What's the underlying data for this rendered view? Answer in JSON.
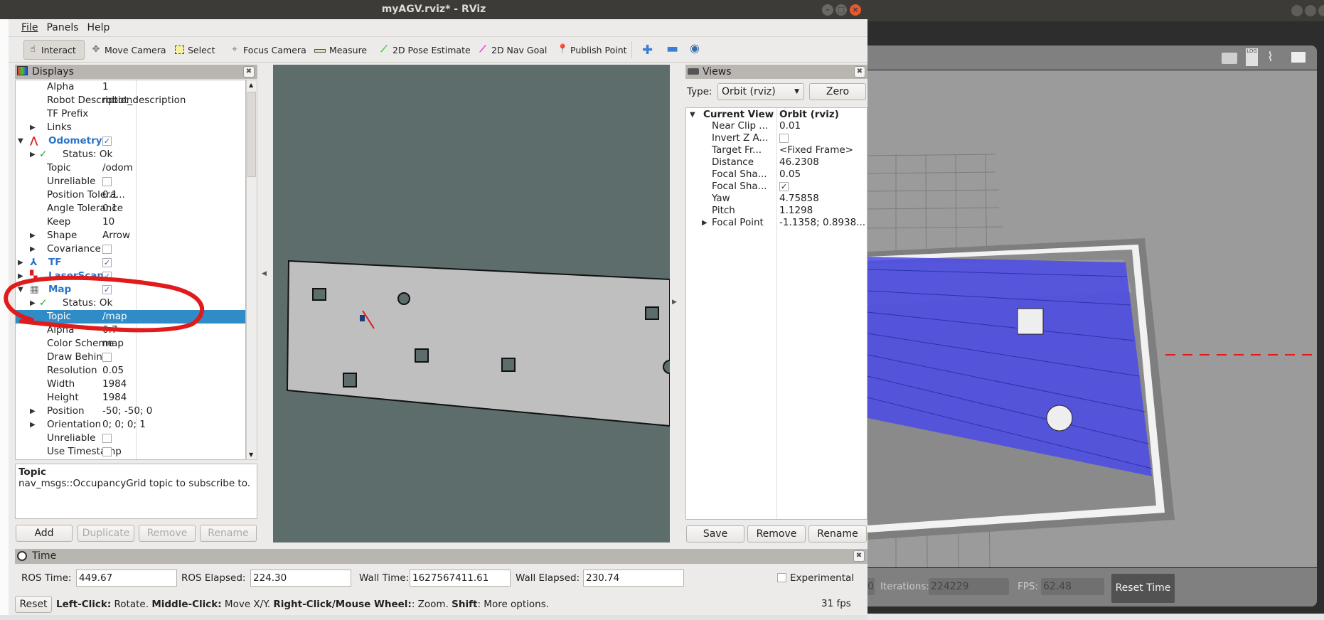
{
  "window": {
    "title": "myAGV.rviz* - RViz",
    "min": "–",
    "max": "□",
    "close": "×"
  },
  "menu": [
    "File",
    "Panels",
    "Help"
  ],
  "toolbar": [
    {
      "label": "Interact",
      "icon": "hand-icon",
      "active": true
    },
    {
      "label": "Move Camera",
      "icon": "move-camera-icon"
    },
    {
      "label": "Select",
      "icon": "select-icon"
    },
    {
      "label": "Focus Camera",
      "icon": "focus-camera-icon"
    },
    {
      "label": "Measure",
      "icon": "ruler-icon"
    },
    {
      "label": "2D Pose Estimate",
      "icon": "pose-arrow-icon",
      "color": "#1fc41f"
    },
    {
      "label": "2D Nav Goal",
      "icon": "goal-arrow-icon",
      "color": "#e01fd4"
    },
    {
      "label": "Publish Point",
      "icon": "map-pin-icon",
      "color": "#c0392b"
    }
  ],
  "displays": {
    "title": "Displays",
    "rows": [
      {
        "name": "Alpha",
        "value": "1",
        "lvl": 2
      },
      {
        "name": "Robot Description",
        "value": "robot_description",
        "lvl": 2
      },
      {
        "name": "TF Prefix",
        "value": "",
        "lvl": 2
      },
      {
        "name": "Links",
        "value": "",
        "lvl": 2,
        "exp": "closed"
      },
      {
        "name": "Odometry",
        "lvl": 0,
        "exp": "open",
        "group": true,
        "check": true,
        "icon": "odometry-icon"
      },
      {
        "name": "Status: Ok",
        "lvl": 1,
        "exp": "closed",
        "status": true
      },
      {
        "name": "Topic",
        "value": "/odom",
        "lvl": 2
      },
      {
        "name": "Unreliable",
        "lvl": 2,
        "check": false
      },
      {
        "name": "Position Tolera...",
        "value": "0.1",
        "lvl": 2
      },
      {
        "name": "Angle Tolerance",
        "value": "0.1",
        "lvl": 2
      },
      {
        "name": "Keep",
        "value": "10",
        "lvl": 2
      },
      {
        "name": "Shape",
        "value": "Arrow",
        "lvl": 2,
        "exp": "closed"
      },
      {
        "name": "Covariance",
        "lvl": 2,
        "exp": "closed",
        "check": false
      },
      {
        "name": "TF",
        "lvl": 0,
        "exp": "closed",
        "group": true,
        "check": true,
        "icon": "tf-icon"
      },
      {
        "name": "LaserScan",
        "lvl": 0,
        "exp": "closed",
        "group": true,
        "check": true,
        "icon": "laserscan-icon"
      },
      {
        "name": "Map",
        "lvl": 0,
        "exp": "open",
        "group": true,
        "check": true,
        "icon": "map-icon"
      },
      {
        "name": "Status: Ok",
        "lvl": 1,
        "exp": "closed",
        "status": true
      },
      {
        "name": "Topic",
        "value": "/map",
        "lvl": 2,
        "selected": true
      },
      {
        "name": "Alpha",
        "value": "0.7",
        "lvl": 2
      },
      {
        "name": "Color Scheme",
        "value": "map",
        "lvl": 2
      },
      {
        "name": "Draw Behind",
        "lvl": 2,
        "check": false
      },
      {
        "name": "Resolution",
        "value": "0.05",
        "lvl": 2
      },
      {
        "name": "Width",
        "value": "1984",
        "lvl": 2
      },
      {
        "name": "Height",
        "value": "1984",
        "lvl": 2
      },
      {
        "name": "Position",
        "value": "-50; -50; 0",
        "lvl": 2,
        "exp": "closed"
      },
      {
        "name": "Orientation",
        "value": "0; 0; 0; 1",
        "lvl": 2,
        "exp": "closed"
      },
      {
        "name": "Unreliable",
        "lvl": 2,
        "check": false
      },
      {
        "name": "Use Timestamp",
        "lvl": 2,
        "check": false
      }
    ],
    "desc_title": "Topic",
    "desc_text": "nav_msgs::OccupancyGrid topic to subscribe to.",
    "buttons": {
      "add": "Add",
      "duplicate": "Duplicate",
      "remove": "Remove",
      "rename": "Rename"
    }
  },
  "views": {
    "title": "Views",
    "type_label": "Type:",
    "type_value": "Orbit (rviz)",
    "zero": "Zero",
    "header": {
      "name": "Current View",
      "value": "Orbit (rviz)"
    },
    "rows": [
      {
        "name": "Near Clip ...",
        "value": "0.01"
      },
      {
        "name": "Invert Z A...",
        "check": false
      },
      {
        "name": "Target Fr...",
        "value": "<Fixed Frame>"
      },
      {
        "name": "Distance",
        "value": "46.2308"
      },
      {
        "name": "Focal Sha...",
        "value": "0.05"
      },
      {
        "name": "Focal Sha...",
        "check": true
      },
      {
        "name": "Yaw",
        "value": "4.75858"
      },
      {
        "name": "Pitch",
        "value": "1.1298"
      },
      {
        "name": "Focal Point",
        "value": "-1.1358; 0.8938...",
        "exp": "closed"
      }
    ],
    "buttons": {
      "save": "Save",
      "remove": "Remove",
      "rename": "Rename"
    }
  },
  "time": {
    "title": "Time",
    "ros_time_label": "ROS Time:",
    "ros_time": "449.67",
    "ros_elapsed_label": "ROS Elapsed:",
    "ros_elapsed": "224.30",
    "wall_time_label": "Wall Time:",
    "wall_time": "1627567411.61",
    "wall_elapsed_label": "Wall Elapsed:",
    "wall_elapsed": "230.74",
    "experimental": "Experimental",
    "reset": "Reset",
    "hint": [
      {
        "b": "Left-Click:",
        "t": " Rotate. "
      },
      {
        "b": "Middle-Click:",
        "t": " Move X/Y. "
      },
      {
        "b": "Right-Click/Mouse Wheel:",
        "t": ": Zoom. "
      },
      {
        "b": "Shift",
        "t": ": More options."
      }
    ],
    "fps": "31 fps"
  },
  "gazebo": {
    "icons": [
      "camera-icon",
      "log-icon",
      "plot-icon",
      "video-icon"
    ],
    "log_text": "LOG",
    "partial_value": "0",
    "iterations_label": "Iterations:",
    "iterations": "224229",
    "fps_label": "FPS:",
    "fps": "62.48",
    "reset_time": "Reset Time"
  },
  "colors": {
    "selection": "#308cc6",
    "group_text": "#2b73c9",
    "map_free": "#bfbfbf",
    "map_unknown": "#5d6d6b",
    "laser_rays": "#4a4ae8",
    "annotation": "#e01b1b"
  }
}
